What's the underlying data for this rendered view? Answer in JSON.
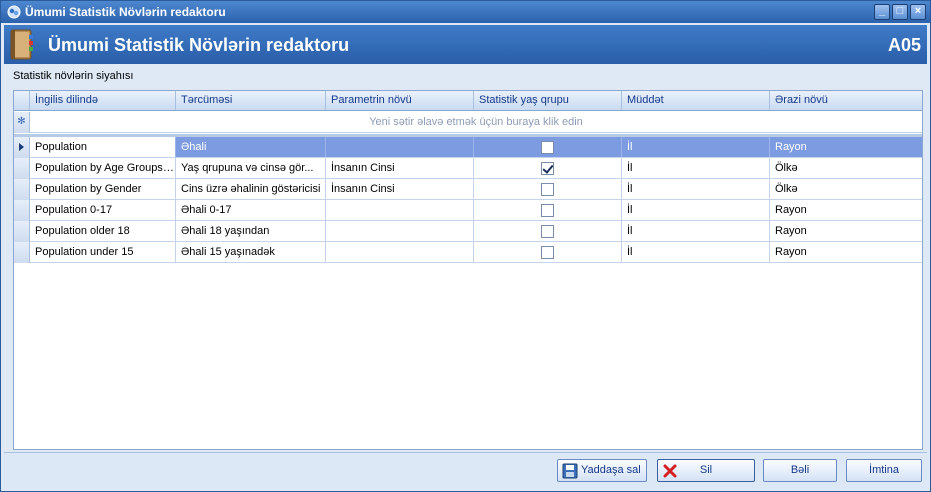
{
  "window": {
    "title": "Ümumi Statistik Növlərin redaktoru"
  },
  "header": {
    "title": "Ümumi Statistik Növlərin redaktoru",
    "code": "A05"
  },
  "list": {
    "label": "Statistik növlərin siyahısı",
    "columns": [
      "İngilis dilində",
      "Tərcüməsi",
      "Parametrin növü",
      "Statistik yaş qrupu",
      "Müddət",
      "Ərazi növü"
    ],
    "new_row_hint": "Yeni sətir əlavə etmək üçün buraya klik edin",
    "new_row_marker": "✻",
    "rows": [
      {
        "english": "Population",
        "translation": "Əhali",
        "parameter": "",
        "age_group": false,
        "period": "İl",
        "area": "Rayon",
        "selected": true
      },
      {
        "english": "Population by Age Groups ...",
        "translation": "Yaş qrupuna və cinsə gör...",
        "parameter": "İnsanın Cinsi",
        "age_group": true,
        "period": "İl",
        "area": "Ölkə",
        "selected": false
      },
      {
        "english": "Population by Gender",
        "translation": "Cins üzrə əhalinin göstəricisi",
        "parameter": "İnsanın Cinsi",
        "age_group": false,
        "period": "İl",
        "area": "Ölkə",
        "selected": false
      },
      {
        "english": "Population 0-17",
        "translation": "Əhali 0-17",
        "parameter": "",
        "age_group": false,
        "period": "İl",
        "area": "Rayon",
        "selected": false
      },
      {
        "english": "Population older 18",
        "translation": "Əhali 18 yaşından",
        "parameter": "",
        "age_group": false,
        "period": "İl",
        "area": "Rayon",
        "selected": false
      },
      {
        "english": "Population under 15",
        "translation": "Əhali 15 yaşınadək",
        "parameter": "",
        "age_group": false,
        "period": "İl",
        "area": "Rayon",
        "selected": false
      }
    ]
  },
  "buttons": {
    "save": "Yaddaşa sal",
    "delete": "Sil",
    "ok": "Bəli",
    "cancel": "İmtina"
  },
  "icons": {
    "app": "app-icon",
    "header": "book-icon",
    "save": "floppy-disk-icon",
    "delete": "red-x-icon"
  },
  "colors": {
    "accent": "#2c62ad",
    "selected_row": "#7d9be0",
    "header_text": "#14398b"
  }
}
